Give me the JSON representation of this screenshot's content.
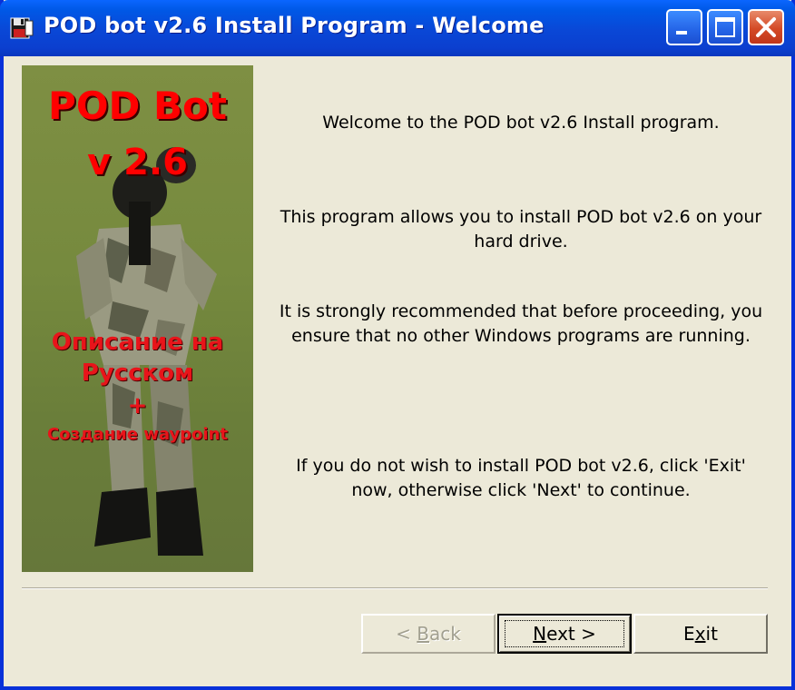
{
  "window": {
    "title": "POD bot v2.6 Install Program  -  Welcome",
    "minimize_label": "_",
    "maximize_label": "□",
    "close_label": "✕"
  },
  "splash": {
    "title_line1": "POD Bot",
    "title_line2": "v 2.6",
    "sub_line1": "Описание на",
    "sub_line2": "Русском",
    "plus": "+",
    "sub_line3": "Создание waypoint"
  },
  "messages": {
    "welcome": "Welcome to the POD bot v2.6 Install program.",
    "allows_line1": "This program allows you to install POD bot v2.6 on your",
    "allows_line2": "hard drive.",
    "recommend_line1": "It is strongly recommended that before proceeding, you",
    "recommend_line2": "ensure that no other Windows programs are running.",
    "exit_line1": "If you do not wish to install POD bot v2.6, click 'Exit'",
    "exit_line2": "now, otherwise click 'Next' to continue."
  },
  "buttons": {
    "back_prefix": "< ",
    "back_access": "B",
    "back_rest": "ack",
    "next_access": "N",
    "next_rest": "ext >",
    "exit_start": "E",
    "exit_access": "x",
    "exit_rest": "it"
  },
  "colors": {
    "titlebar": "#0a47d6",
    "face": "#ece9d8",
    "splash_text": "#ff0000"
  }
}
